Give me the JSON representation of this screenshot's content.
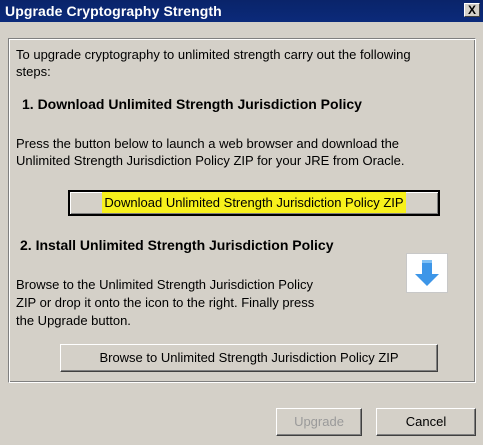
{
  "window": {
    "title": "Upgrade Cryptography Strength",
    "close_glyph": "X"
  },
  "intro": {
    "line1": "To upgrade cryptography to unlimited strength carry out the following",
    "line2": "steps:"
  },
  "step1": {
    "heading": "1. Download Unlimited Strength Jurisdiction Policy",
    "desc_line1": "Press the button below to launch a web browser and download the",
    "desc_line2": "Unlimited Strength Jurisdiction Policy ZIP for your JRE from Oracle.",
    "button_label": "Download Unlimited Strength Jurisdiction Policy ZIP"
  },
  "step2": {
    "heading": "2. Install Unlimited Strength Jurisdiction Policy",
    "desc_line1": "Browse to the Unlimited Strength Jurisdiction Policy",
    "desc_line2": "ZIP or drop it onto the icon to the right. Finally press",
    "desc_line3": "the Upgrade button.",
    "button_label": "Browse to Unlimited Strength Jurisdiction Policy ZIP",
    "drop_icon": "down-arrow-icon"
  },
  "footer": {
    "upgrade_label": "Upgrade",
    "cancel_label": "Cancel"
  },
  "colors": {
    "titlebar": "#0a246a",
    "highlight": "#f7f01c",
    "arrow": "#3d96e8"
  }
}
